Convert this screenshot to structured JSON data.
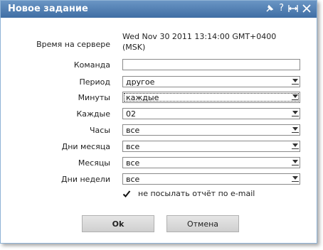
{
  "dialog": {
    "title": "Новое задание",
    "icons": [
      "pin-icon",
      "help-icon",
      "maximize-icon",
      "close-icon"
    ]
  },
  "server": {
    "label": "Время на сервере",
    "value": "Wed Nov 30 2011 13:14:00 GMT+0400 (MSK)"
  },
  "form": {
    "command_label": "Команда",
    "command_value": "",
    "period_label": "Период",
    "period_value": "другое",
    "minutes_label": "Минуты",
    "minutes_value": "каждые",
    "every_label": "Каждые",
    "every_value": "02",
    "hours_label": "Часы",
    "hours_value": "все",
    "days_of_month_label": "Дни месяца",
    "days_of_month_value": "все",
    "months_label": "Месяцы",
    "months_value": "все",
    "weekdays_label": "Дни недели",
    "weekdays_value": "все",
    "no_email_label": "не посылать отчёт по e-mail",
    "no_email_checked": true
  },
  "buttons": {
    "ok": "Ok",
    "cancel": "Отмена"
  },
  "colors": {
    "titlebar": "#4a79ad",
    "border": "#8fb3d6"
  }
}
